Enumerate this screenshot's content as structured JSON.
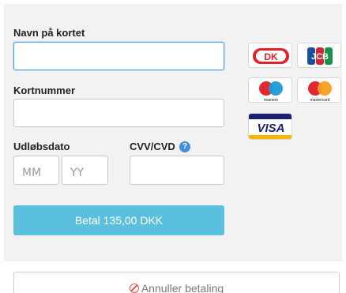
{
  "form": {
    "card_name_label": "Navn på kortet",
    "card_number_label": "Kortnummer",
    "expiry_label": "Udløbsdato",
    "expiry_month_placeholder": "MM",
    "expiry_year_placeholder": "YY",
    "cvv_label": "CVV/CVD",
    "cvv_help_glyph": "?",
    "pay_button_label": "Betal 135,00 DKK"
  },
  "card_logos": {
    "dankort": "DK",
    "jcb": "JCB",
    "maestro": "maestro",
    "mastercard": "mastercard",
    "visa": "VISA"
  },
  "cancel": {
    "label": "Annuller betaling"
  },
  "colors": {
    "pay_button": "#5bc0de",
    "focus_border": "#5aa0e6",
    "help_icon": "#3d8fe0",
    "cancel_icon": "#e05a4f"
  }
}
